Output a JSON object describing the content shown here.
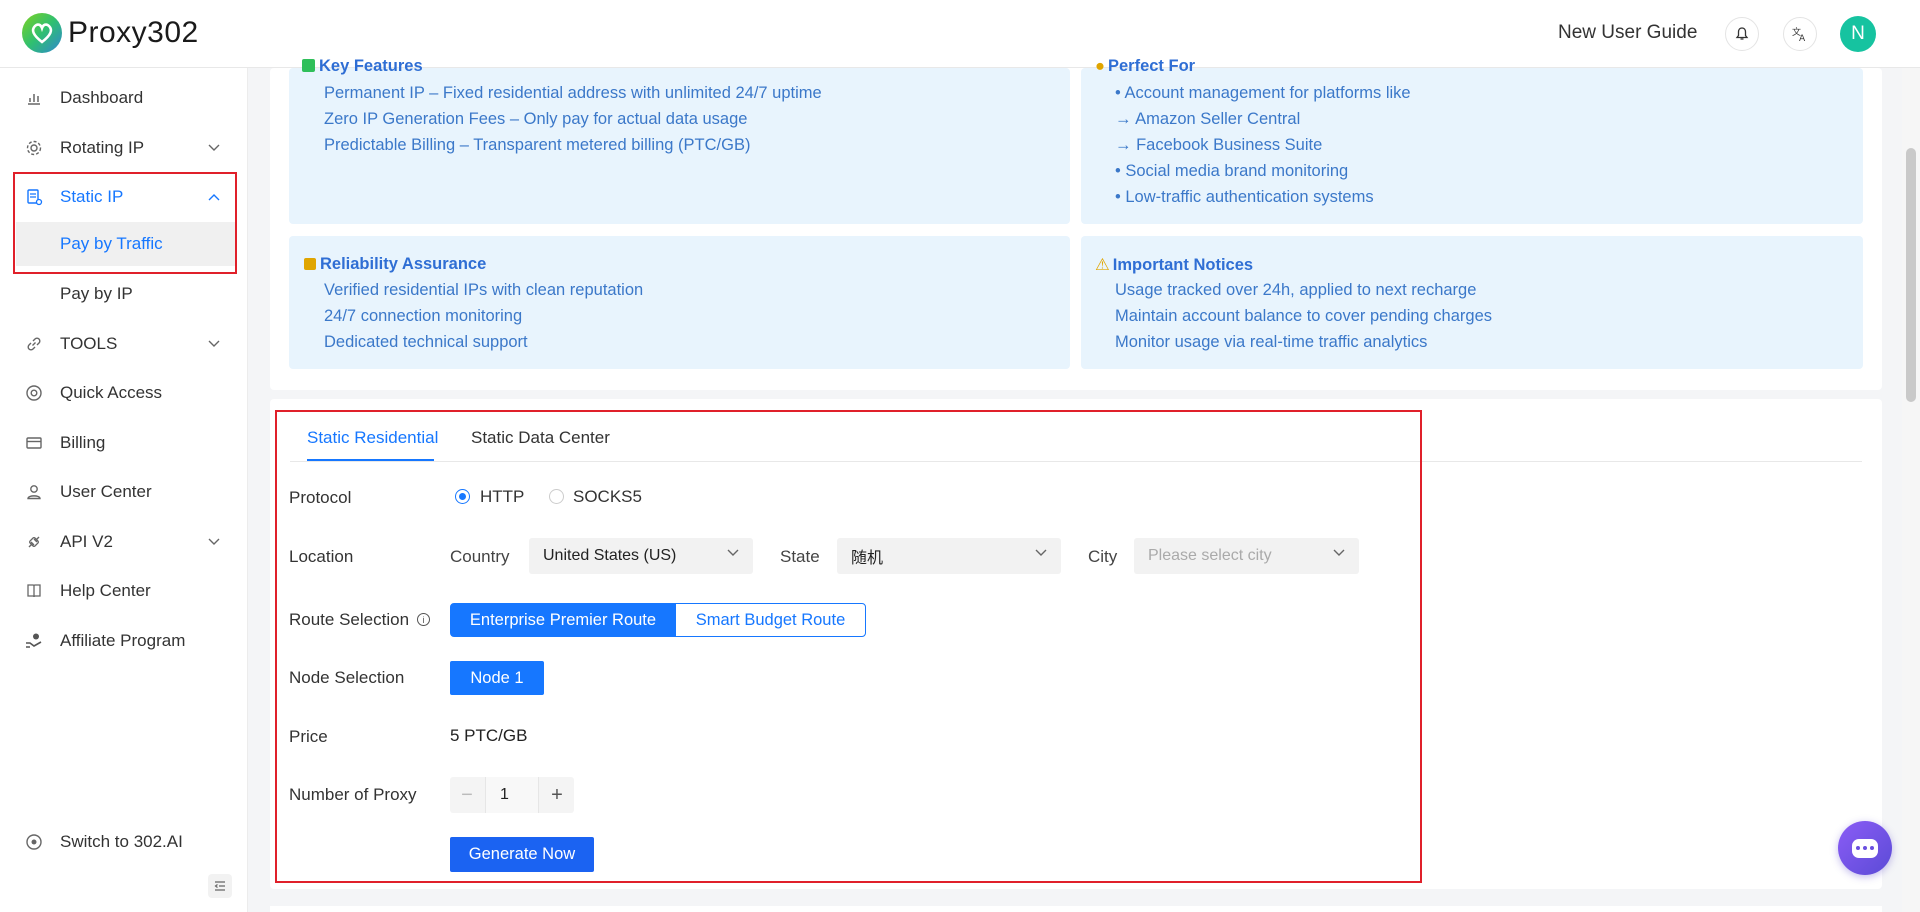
{
  "header": {
    "logo_text": "Proxy302",
    "new_user_guide": "New User Guide",
    "avatar_initial": "N"
  },
  "sidebar": {
    "items": [
      {
        "label": "Dashboard",
        "icon": "bar-chart-icon"
      },
      {
        "label": "Rotating IP",
        "icon": "gear-icon",
        "expandable": true
      },
      {
        "label": "Static IP",
        "icon": "server-icon",
        "expandable": true,
        "expanded": true,
        "active": true
      },
      {
        "label": "Pay by Traffic",
        "sub": true,
        "selected": true
      },
      {
        "label": "Pay by IP",
        "sub": true
      },
      {
        "label": "TOOLS",
        "icon": "link-icon",
        "expandable": true
      },
      {
        "label": "Quick Access",
        "icon": "chrome-icon"
      },
      {
        "label": "Billing",
        "icon": "credit-card-icon"
      },
      {
        "label": "User Center",
        "icon": "user-icon"
      },
      {
        "label": "API V2",
        "icon": "api-icon",
        "expandable": true
      },
      {
        "label": "Help Center",
        "icon": "book-icon"
      },
      {
        "label": "Affiliate Program",
        "icon": "affiliate-icon"
      }
    ],
    "switch_label": "Switch to 302.AI"
  },
  "info": {
    "key_features": {
      "title": "Key Features",
      "lines": [
        "Permanent IP – Fixed residential address with unlimited 24/7 uptime",
        "Zero IP Generation Fees – Only pay for actual data usage",
        "Predictable Billing – Transparent metered billing (PTC/GB)"
      ]
    },
    "perfect_for": {
      "title": "Perfect For",
      "lines": [
        "• Account management for platforms like",
        "→ Amazon Seller Central",
        "→ Facebook Business Suite",
        "• Social media brand monitoring",
        "• Low-traffic authentication systems"
      ]
    },
    "reliability": {
      "title": "Reliability Assurance",
      "lines": [
        "Verified residential IPs with clean reputation",
        "24/7 connection monitoring",
        "Dedicated technical support"
      ]
    },
    "notices": {
      "title": "Important Notices",
      "lines": [
        "Usage tracked over 24h, applied to next recharge",
        "Maintain account balance to cover pending charges",
        "Monitor usage via real-time traffic analytics"
      ]
    }
  },
  "tabs": [
    "Static Residential",
    "Static Data Center"
  ],
  "form": {
    "protocol_label": "Protocol",
    "protocol_options": [
      "HTTP",
      "SOCKS5"
    ],
    "protocol_selected": "HTTP",
    "location_label": "Location",
    "country_label": "Country",
    "country_value": "United States (US)",
    "state_label": "State",
    "state_value": "随机",
    "city_label": "City",
    "city_placeholder": "Please select city",
    "route_label": "Route Selection",
    "route_options": [
      "Enterprise Premier Route",
      "Smart Budget Route"
    ],
    "route_selected": "Enterprise Premier Route",
    "node_label": "Node Selection",
    "node_value": "Node 1",
    "price_label": "Price",
    "price_value": "5  PTC/GB",
    "proxy_count_label": "Number of Proxy",
    "proxy_count": "1",
    "generate_label": "Generate Now"
  },
  "colors": {
    "accent": "#1677ff",
    "info_bg": "#e8f4fd",
    "highlight_border": "#e0202a",
    "avatar": "#16c3a0"
  }
}
